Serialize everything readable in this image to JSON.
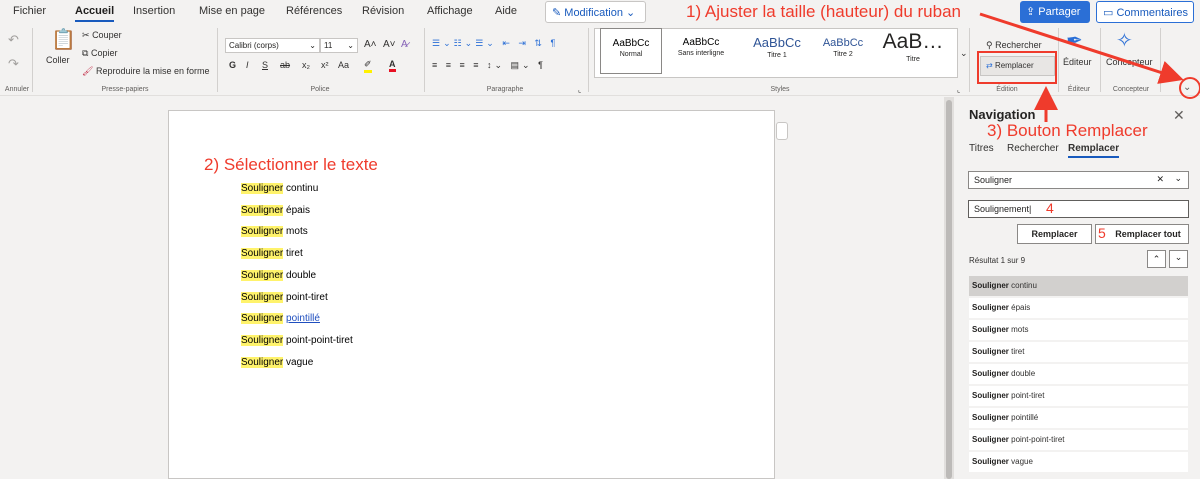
{
  "menubar": {
    "items": [
      "Fichier",
      "Accueil",
      "Insertion",
      "Mise en page",
      "Références",
      "Révision",
      "Affichage",
      "Aide"
    ],
    "mode": "Modification",
    "share": "Partager",
    "comments": "Commentaires"
  },
  "ribbon": {
    "undo_group": "Annuler",
    "clipboard": {
      "paste": "Coller",
      "cut": "Couper",
      "copy": "Copier",
      "format_painter": "Reproduire la mise en forme",
      "label": "Presse-papiers"
    },
    "font": {
      "family": "Calibri (corps)",
      "size": "11",
      "bold": "G",
      "italic": "I",
      "underline": "S",
      "strike": "ab",
      "sub": "x₂",
      "sup": "x²",
      "case": "Aa",
      "label": "Police"
    },
    "paragraph": {
      "label": "Paragraphe"
    },
    "styles": {
      "items": [
        {
          "sample": "AaBbCc",
          "name": "Normal"
        },
        {
          "sample": "AaBbCc",
          "name": "Sans interligne"
        },
        {
          "sample": "AaBbCc",
          "name": "Titre 1"
        },
        {
          "sample": "AaBbCc",
          "name": "Titre 2"
        },
        {
          "sample": "AaB…",
          "name": "Titre"
        }
      ],
      "label": "Styles"
    },
    "edit": {
      "search": "Rechercher",
      "replace": "Remplacer",
      "label": "Édition"
    },
    "editor": {
      "name": "Éditeur",
      "label": "Éditeur"
    },
    "designer": {
      "name": "Concepteur",
      "label": "Concepteur"
    }
  },
  "document": {
    "lines": [
      {
        "word": "Souligner",
        "rest": "continu"
      },
      {
        "word": "Souligner",
        "rest": "épais"
      },
      {
        "word": "Souligner",
        "rest": "mots"
      },
      {
        "word": "Souligner",
        "rest": "tiret"
      },
      {
        "word": "Souligner",
        "rest": "double"
      },
      {
        "word": "Souligner",
        "rest": "point-tiret"
      },
      {
        "word": "Souligner",
        "rest": "pointillé"
      },
      {
        "word": "Souligner",
        "rest": "point-point-tiret"
      },
      {
        "word": "Souligner",
        "rest": "vague"
      }
    ]
  },
  "nav": {
    "title": "Navigation",
    "tabs": [
      "Titres",
      "Rechercher",
      "Remplacer"
    ],
    "find_value": "Souligner",
    "replace_value": "Soulignement",
    "replace_btn": "Remplacer",
    "replace_all_btn": "Remplacer tout",
    "result_count": "Résultat 1 sur 9",
    "results": [
      {
        "word": "Souligner",
        "rest": "continu"
      },
      {
        "word": "Souligner",
        "rest": "épais"
      },
      {
        "word": "Souligner",
        "rest": "mots"
      },
      {
        "word": "Souligner",
        "rest": "tiret"
      },
      {
        "word": "Souligner",
        "rest": "double"
      },
      {
        "word": "Souligner",
        "rest": "point-tiret"
      },
      {
        "word": "Souligner",
        "rest": "pointillé"
      },
      {
        "word": "Souligner",
        "rest": "point-point-tiret"
      },
      {
        "word": "Souligner",
        "rest": "vague"
      }
    ]
  },
  "annotations": {
    "a1": "1) Ajuster la taille (hauteur) du ruban",
    "a2": "2) Sélectionner le texte",
    "a3": "3) Bouton Remplacer",
    "a4": "4",
    "a5": "5"
  },
  "colors": {
    "accent": "#185abd",
    "annotation": "#ef3b2c",
    "highlight": "#fff36b"
  }
}
